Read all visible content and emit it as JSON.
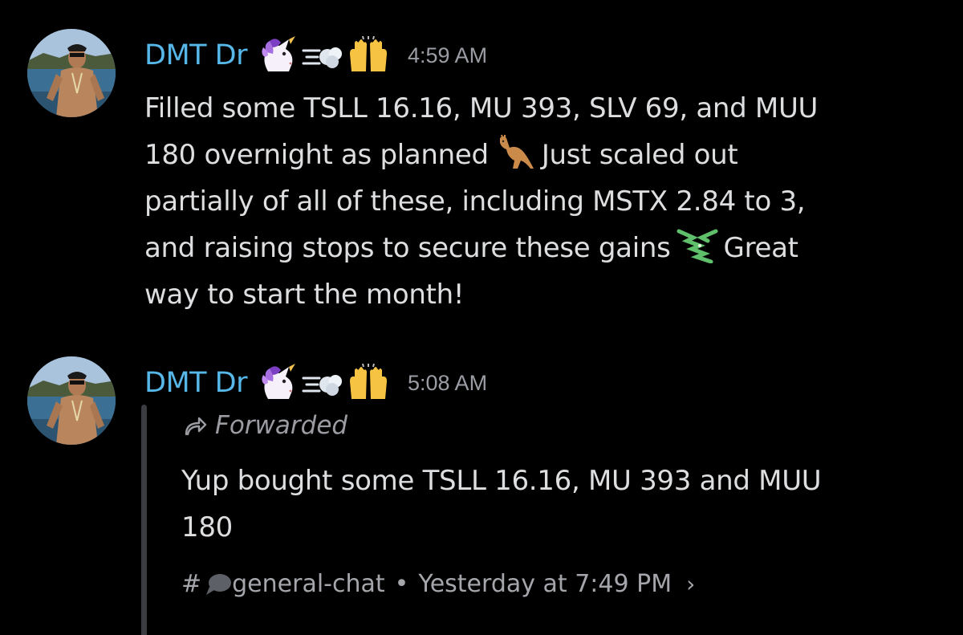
{
  "messages": [
    {
      "username": "DMT Dr",
      "timestamp": "4:59 AM",
      "badges": [
        "unicorn-icon",
        "dash-icon",
        "raising-hands-icon"
      ],
      "text": {
        "line1": "Filled some TSLL 16.16, MU 393, SLV 69, and MUU",
        "line2a": "180 overnight as planned",
        "line2b": "Just scaled out",
        "line3": "partially of all of these, including MSTX 2.84 to 3,",
        "line4a": "and raising stops to secure these gains",
        "line4b": "Great",
        "line5": "way to start the month!"
      },
      "inline_icons": [
        "kangaroo-icon",
        "money-with-wings-icon"
      ]
    },
    {
      "username": "DMT Dr",
      "timestamp": "5:08 AM",
      "badges": [
        "unicorn-icon",
        "dash-icon",
        "raising-hands-icon"
      ],
      "forwarded": {
        "label": "Forwarded",
        "line1": "Yup bought some TSLL 16.16, MU 393 and MUU",
        "line2": "180",
        "source": {
          "hash": "#",
          "channel": "general-chat",
          "separator": "•",
          "time": "Yesterday at 7:49 PM",
          "chevron": "›"
        }
      }
    }
  ],
  "colors": {
    "background": "#000000",
    "username": "#56b7e8",
    "text": "#dddee0",
    "muted": "#9a9da3",
    "forward_bar": "#3a3c42"
  }
}
